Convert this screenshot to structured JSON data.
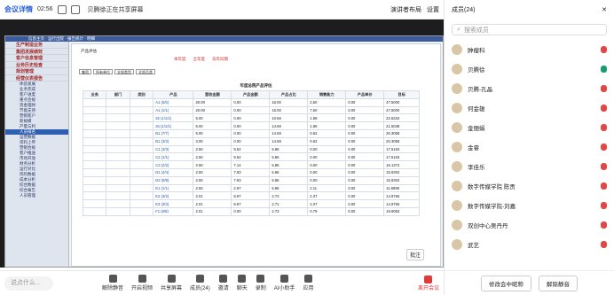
{
  "topbar": {
    "logo": "会议详情",
    "time": "02:56",
    "share": "贝腾徐正在共享屏幕",
    "speaker": "演讲者布局",
    "settings": "设置"
  },
  "app": {
    "tabs": "信息主页 · 运行出院 · 报告统计 · 明细",
    "nav": [
      "生产制造业务",
      "集团发展绩效",
      "客户信息管理",
      "业务历史检查",
      "规划管理",
      "经营仪表报告"
    ],
    "subs": [
      "体验发展",
      "业务完成",
      "客户进度",
      "重点合规",
      "资金理财",
      "节能支持",
      "营销客户",
      "新规模",
      "产量与利",
      "人员排名",
      "运营数据",
      "资料上传",
      "营销合规",
      "客户推送",
      "市场开放",
      "财务分析",
      "运行对比",
      "风险数据",
      "成本分析",
      "综合数据",
      "综合报告",
      "人员管理"
    ],
    "report_title": "产品评估",
    "radios": [
      "本年度",
      "全年度",
      "去年同期"
    ],
    "filters": [
      "集团",
      "所有单位",
      "全部类型",
      "全部品类"
    ],
    "table_title": "年度总院产品评估",
    "pizhu": "批注"
  },
  "table": {
    "headers": [
      "业务",
      "部门",
      "类别",
      "产品",
      "营收金额",
      "产品金额",
      "产品占比",
      "销售能力",
      "产品单价",
      "目标"
    ],
    "rows": [
      [
        "",
        "",
        "",
        "A1 (5/5)",
        "20.00",
        "0.00",
        "16.00",
        "2.50",
        "0.00",
        "47.5000"
      ],
      [
        "",
        "",
        "",
        "A1 (1/1)",
        "20.00",
        "0.00",
        "16.00",
        "7.50",
        "0.00",
        "47.5000"
      ],
      [
        "",
        "",
        "",
        "32 (1/1/1)",
        "5.00",
        "0.00",
        "10.56",
        "1.88",
        "0.00",
        "22.6334"
      ],
      [
        "",
        "",
        "",
        "34 (1/1/1)",
        "5.00",
        "0.00",
        "14.68",
        "1.88",
        "0.00",
        "21.5038"
      ],
      [
        "",
        "",
        "",
        "B1 (7/7)",
        "5.00",
        "0.00",
        "14.68",
        "0.62",
        "0.00",
        "20.3058"
      ],
      [
        "",
        "",
        "",
        "B1 (3/3)",
        "3.00",
        "0.00",
        "14.68",
        "0.62",
        "0.00",
        "20.3058"
      ],
      [
        "",
        "",
        "",
        "C1 (3/3)",
        "2.50",
        "9.52",
        "5.86",
        "0.00",
        "0.00",
        "17.5163"
      ],
      [
        "",
        "",
        "",
        "C2 (1/1)",
        "2.50",
        "9.52",
        "5.86",
        "0.00",
        "0.00",
        "17.5163"
      ],
      [
        "",
        "",
        "",
        "C3 (2/2)",
        "2.50",
        "7.14",
        "5.86",
        "0.00",
        "0.00",
        "16.1372"
      ],
      [
        "",
        "",
        "",
        "D1 (4/4)",
        "2.50",
        "7.93",
        "5.86",
        "0.00",
        "0.00",
        "15.9302"
      ],
      [
        "",
        "",
        "",
        "D2 (9/9)",
        "2.50",
        "7.93",
        "5.86",
        "0.00",
        "0.00",
        "15.9302"
      ],
      [
        "",
        "",
        "",
        "E1 (1/1)",
        "2.50",
        "2.97",
        "5.86",
        "2.11",
        "0.00",
        "11.9899"
      ],
      [
        "",
        "",
        "",
        "E2 (3/3)",
        "2.01",
        "8.97",
        "2.73",
        "2.37",
        "0.00",
        "14.9765"
      ],
      [
        "",
        "",
        "",
        "E3 (3/3)",
        "2.01",
        "8.97",
        "2.71",
        "2.37",
        "0.00",
        "14.9765"
      ],
      [
        "",
        "",
        "",
        "F1 (8/8)",
        "2.01",
        "0.00",
        "2.73",
        "0.79",
        "0.00",
        "19.6083"
      ]
    ]
  },
  "right": {
    "title": "成员(24)",
    "search": "搜索成员",
    "members": [
      "肿瘤科",
      "贝腾徐",
      "贝腾-孔晶",
      "何金雄",
      "金丽娟",
      "金睿",
      "李佳乐",
      "数字传媒学院 陈贡",
      "数字传媒学院-刘嘉",
      "双创中心吴丹丹",
      "武艺"
    ],
    "btn1": "修改会中昵称",
    "btn2": "解除静音"
  },
  "bottom": {
    "say": "说点什么...",
    "tools": [
      "解除静音",
      "开启视频",
      "共享屏幕",
      "成员(24)",
      "邀请",
      "聊天",
      "录制",
      "AI小助手",
      "应用"
    ],
    "leave": "离开会议"
  }
}
